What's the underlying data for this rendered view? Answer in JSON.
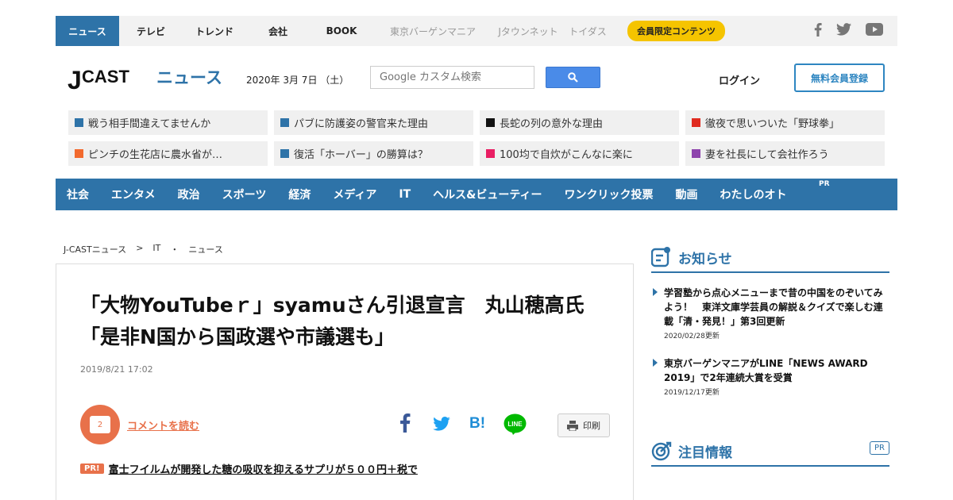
{
  "topbar": {
    "tabs": [
      {
        "label": "ニュース"
      },
      {
        "label": "テレビ"
      },
      {
        "label": "トレンド"
      },
      {
        "label": "会社"
      },
      {
        "label": "BOOK"
      },
      {
        "label": "東京バーゲンマニア"
      },
      {
        "label": "Jタウンネット"
      },
      {
        "label": "トイダス"
      }
    ],
    "member_label": "会員限定コンテンツ",
    "social_icons": [
      "facebook-icon",
      "twitter-icon",
      "youtube-icon"
    ]
  },
  "header": {
    "logo_j": "J",
    "logo_cast": "CAST",
    "logo_news": "ニュース",
    "date": "2020年 3月 7日 （土）",
    "search_placeholder": "Google カスタム検索",
    "login_label": "ログイン",
    "register_label": "無料会員登録"
  },
  "headline_links": [
    {
      "label": "戦う相手間違えてませんか",
      "color": "#2e73a8"
    },
    {
      "label": "パブに防護姿の警官来た理由",
      "color": "#2e73a8"
    },
    {
      "label": "長蛇の列の意外な理由",
      "color": "#111111"
    },
    {
      "label": "徹夜で思いついた「野球拳」",
      "color": "#e02b20"
    },
    {
      "label": "ピンチの生花店に農水省が…",
      "color": "#f26a2e"
    },
    {
      "label": "復活「ホーバー」の勝算は？",
      "color": "#2e73a8"
    },
    {
      "label": "100均で自炊がこんなに楽に",
      "color": "#e91e63"
    },
    {
      "label": "妻を社長にして会社作ろう",
      "color": "#8e44ad"
    }
  ],
  "categories": [
    {
      "label": "社会"
    },
    {
      "label": "エンタメ"
    },
    {
      "label": "政治"
    },
    {
      "label": "スポーツ"
    },
    {
      "label": "経済"
    },
    {
      "label": "メディア"
    },
    {
      "label": "IT"
    },
    {
      "label": "ヘルス&ビューティー"
    },
    {
      "label": "ワンクリック投票"
    },
    {
      "label": "動画"
    },
    {
      "label": "わたしのオト"
    }
  ],
  "category_pr": "PR",
  "breadcrumb": {
    "home": "J-CASTニュース",
    "sep1": ">",
    "section": "IT",
    "sep2": "・",
    "sub": "ニュース"
  },
  "article": {
    "title": "「大物YouTubeｒ」syamuさん引退宣言　丸山穂高氏「是非N国から国政選や市議選も」",
    "date": "2019/8/21 17:02",
    "comment_count": "2",
    "comment_link": "コメントを読む",
    "print_label": "印刷",
    "share_icons": [
      "facebook-share-icon",
      "twitter-share-icon",
      "hatena-bookmark-icon",
      "line-share-icon"
    ],
    "hatena_label": "B!",
    "line_label": "LINE",
    "pr_badge": "PR!",
    "pr_text": "富士フイルムが開発した糖の吸収を抑えるサプリが５００円＋税で"
  },
  "sidebar": {
    "notice_title": "お知らせ",
    "notices": [
      {
        "text": "学習塾から点心メニューまで昔の中国をのぞいてみよう！　東洋文庫学芸員の解説＆クイズで楽しむ連載「清・発見！」第3回更新",
        "date": "2020/02/28更新"
      },
      {
        "text": "東京バーゲンマニアがLINE「NEWS AWARD 2019」で2年連続大賞を受賞",
        "date": "2019/12/17更新"
      }
    ],
    "attention_title": "注目情報",
    "attention_pr": "PR"
  }
}
